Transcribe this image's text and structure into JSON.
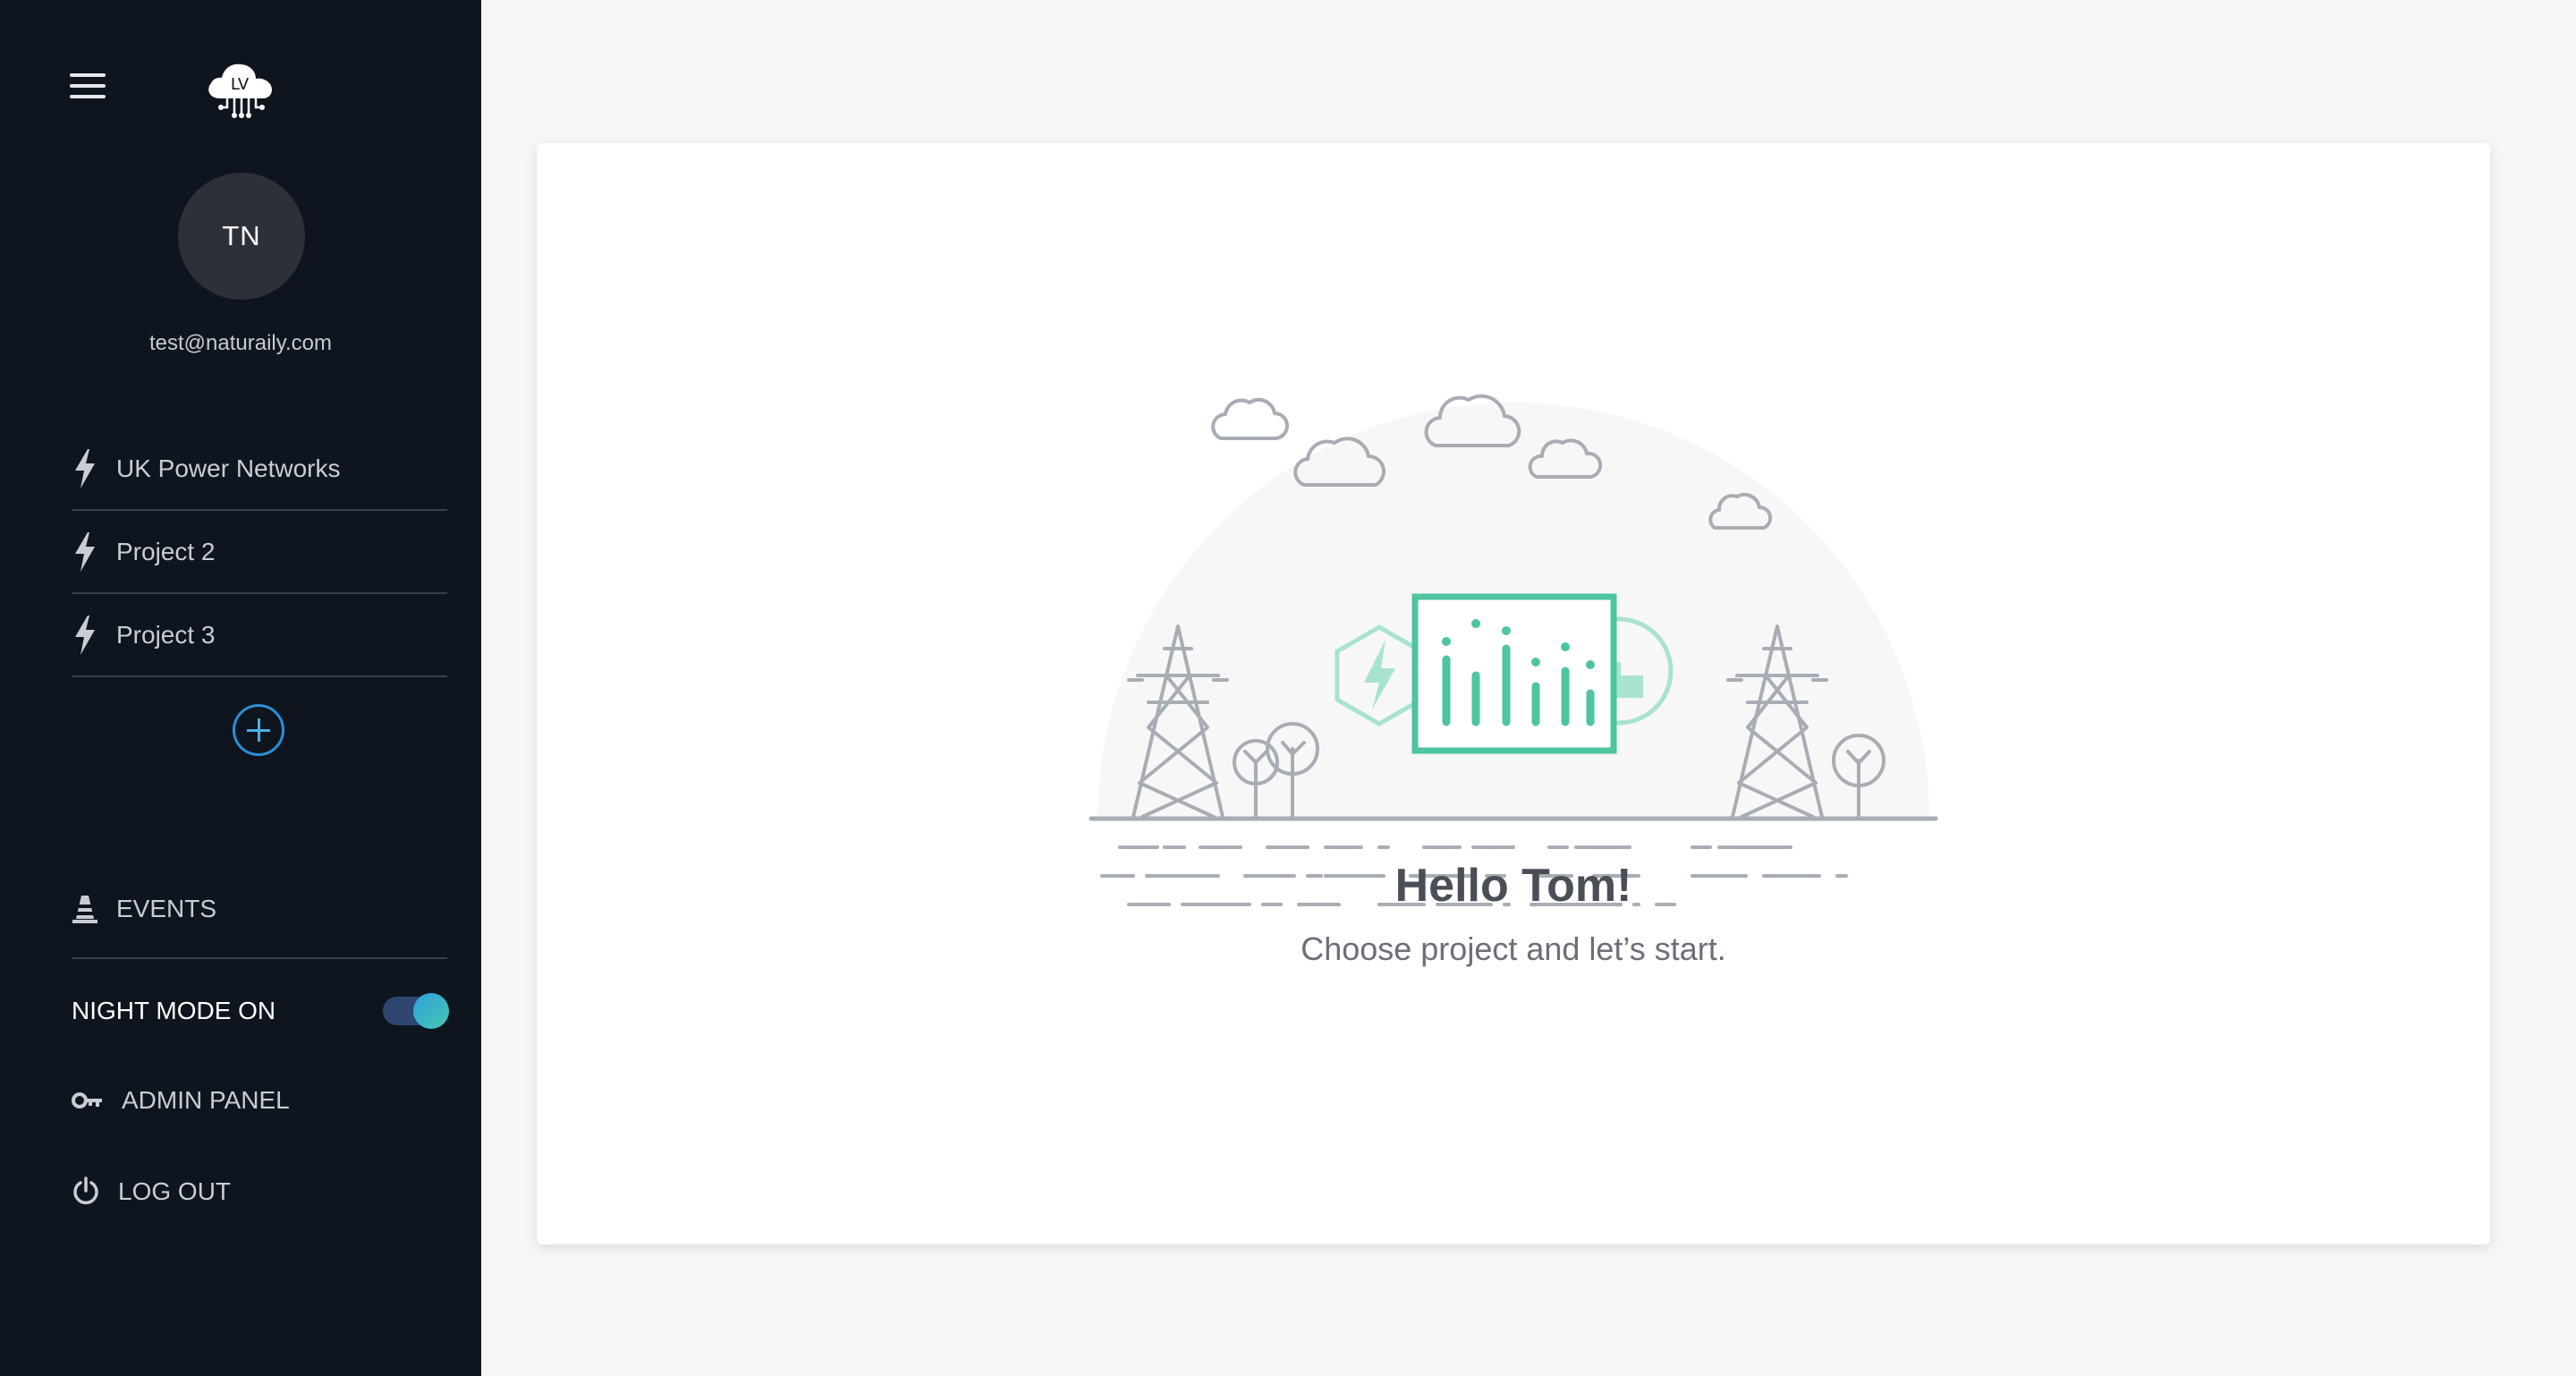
{
  "app": {
    "logo_text": "LV"
  },
  "user": {
    "initials": "TN",
    "email": "test@naturaily.com"
  },
  "sidebar": {
    "projects": [
      {
        "label": "UK Power Networks"
      },
      {
        "label": "Project 2"
      },
      {
        "label": "Project 3"
      }
    ],
    "events_label": "EVENTS",
    "night_mode_label": "NIGHT MODE ON",
    "night_mode_on": true,
    "admin_label": "ADMIN PANEL",
    "logout_label": "LOG OUT"
  },
  "main": {
    "greeting": "Hello Tom!",
    "subtitle": "Choose project and let’s start."
  },
  "colors": {
    "sidebar_bg": "#0f151e",
    "accent_green": "#4cc5a0",
    "accent_blue": "#2a8fd6",
    "toggle_track": "#2f4670",
    "illustration_gray": "#a8adb5"
  }
}
